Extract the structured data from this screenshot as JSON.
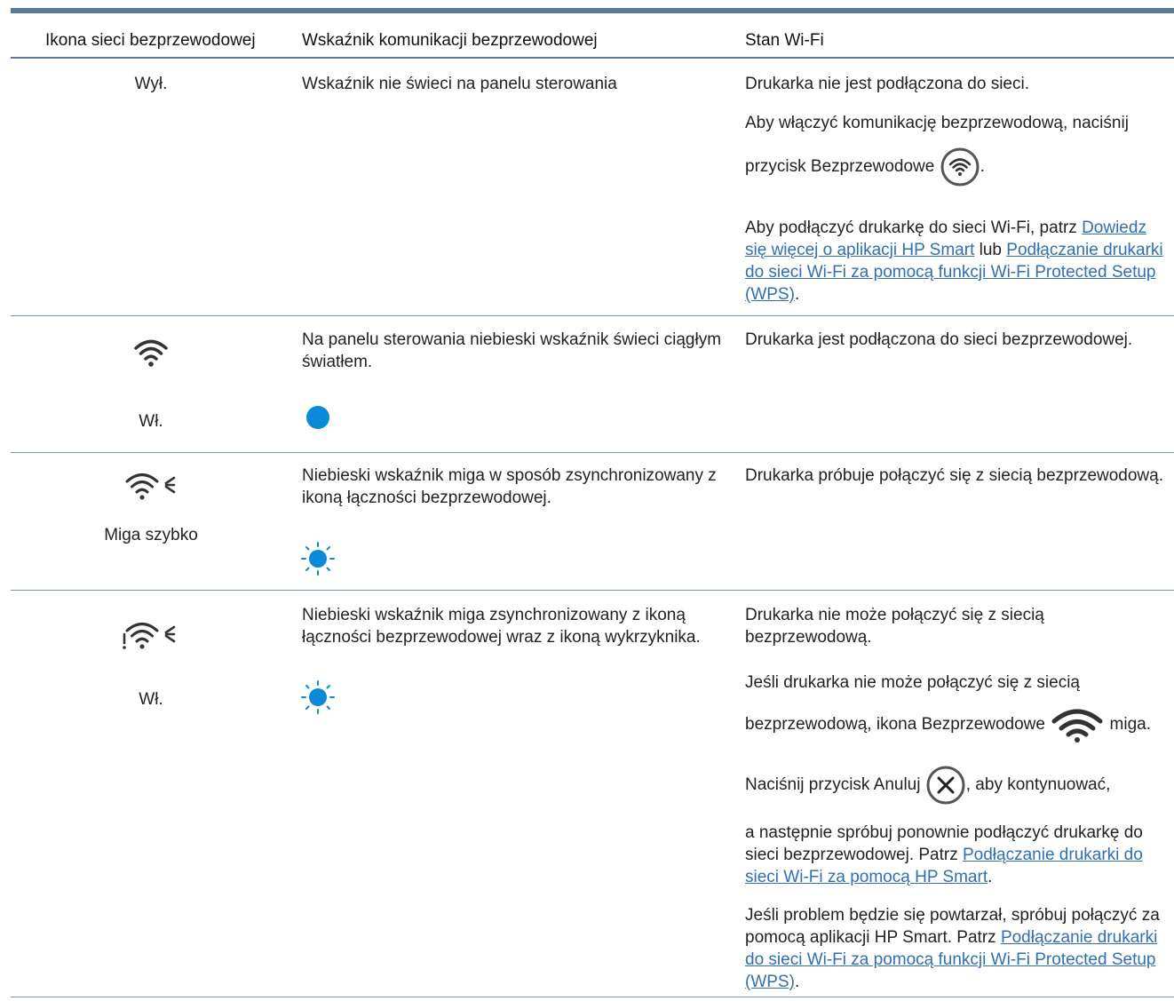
{
  "colors": {
    "accent": "#5a7b99",
    "link": "#2f6fb6",
    "led_blue": "#0a8ad6"
  },
  "table": {
    "headers": [
      "Ikona sieci bezprzewodowej",
      "Wskaźnik komunikacji bezprzewodowej",
      "Stan Wi-Fi"
    ],
    "rows": [
      {
        "icon_state": "Wył.",
        "indicator_text": "Wskaźnik nie świeci na panelu sterowania",
        "status": {
          "p1": "Drukarka nie jest podłączona do sieci.",
          "p2a": "Aby włączyć komunikację bezprzewodową, naciśnij",
          "p2b": "przycisk Bezprzewodowe",
          "p2c": ".",
          "p3a": "Aby podłączyć drukarkę do sieci Wi-Fi, patrz ",
          "p3_link1": "Dowiedz się więcej o aplikacji HP Smart",
          "p3b": " lub ",
          "p3_link2": "Podłączanie drukarki do sieci Wi-Fi za pomocą funkcji Wi-Fi Protected Setup (WPS)",
          "p3c": "."
        }
      },
      {
        "icon_name": "wifi-icon",
        "icon_state": "Wł.",
        "indicator_text": "Na panelu sterowania niebieski wskaźnik świeci ciągłym światłem.",
        "indicator_icon": "solid-blue-led-icon",
        "status": {
          "p1": "Drukarka jest podłączona do sieci bezprzewodowej."
        }
      },
      {
        "icon_name": "wifi-blinking-icon",
        "icon_state": "Miga szybko",
        "indicator_text": "Niebieski wskaźnik miga w sposób zsynchronizowany z ikoną łączności bezprzewodowej.",
        "indicator_icon": "blinking-blue-led-icon",
        "status": {
          "p1": "Drukarka próbuje połączyć się z siecią bezprzewodową."
        }
      },
      {
        "icon_name": "wifi-blinking-exclamation-icon",
        "icon_state": "Wł.",
        "indicator_text": "Niebieski wskaźnik miga zsynchronizowany z ikoną łączności bezprzewodowej wraz z ikoną wykrzyknika.",
        "indicator_icon": "blinking-blue-led-icon",
        "status": {
          "p1": "Drukarka nie może połączyć się z siecią bezprzewodową.",
          "p2a": "Jeśli drukarka nie może połączyć się z siecią",
          "p2b": "bezprzewodową, ikona Bezprzewodowe",
          "p2c": "miga.",
          "p3a": "Naciśnij przycisk Anuluj",
          "p3b": ", aby kontynuować,",
          "p4a": "a następnie spróbuj ponownie podłączyć drukarkę do sieci bezprzewodowej. Patrz ",
          "p4_link": "Podłączanie drukarki do sieci Wi-Fi za pomocą HP Smart",
          "p4b": ".",
          "p5a": "Jeśli problem będzie się powtarzał, spróbuj połączyć za pomocą aplikacji HP Smart. Patrz ",
          "p5_link": "Podłączanie drukarki do sieci Wi-Fi za pomocą funkcji Wi-Fi Protected Setup (WPS)",
          "p5b": "."
        }
      }
    ]
  }
}
